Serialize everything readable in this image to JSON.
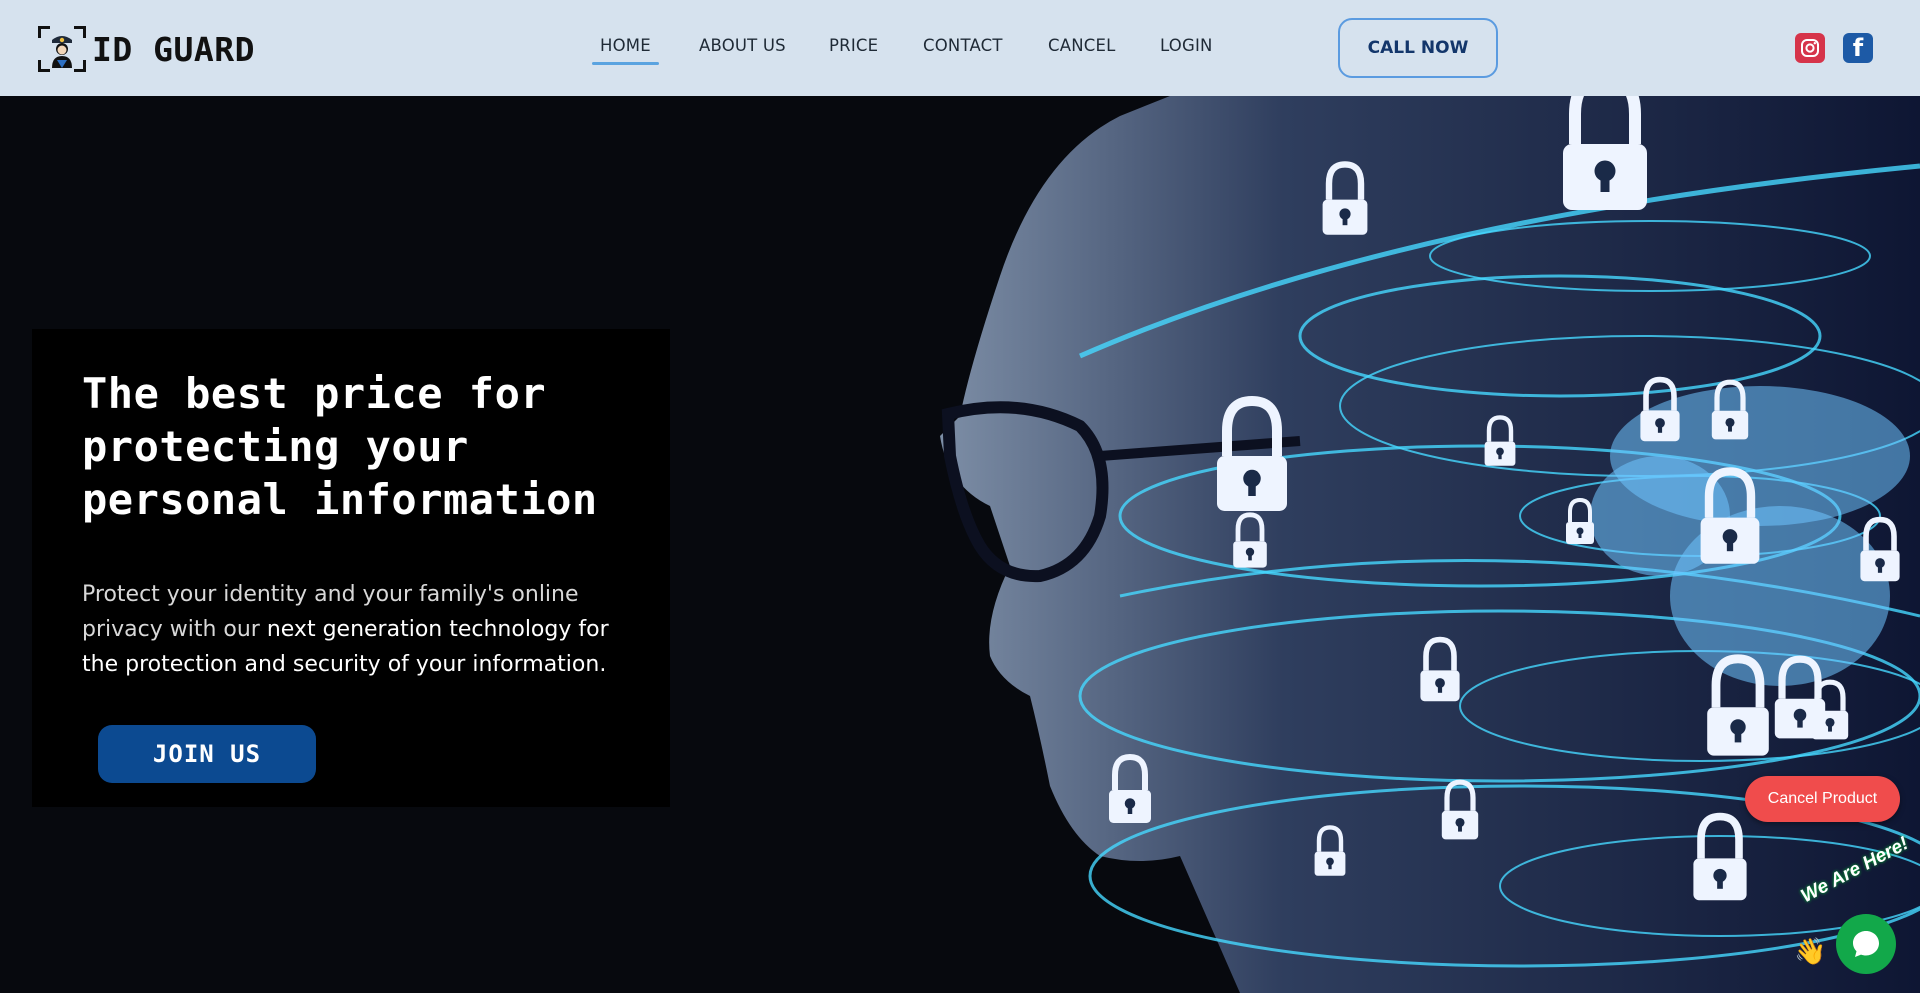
{
  "brand": {
    "name": "ID GUARD",
    "logo_icon": "guard-officer-icon"
  },
  "nav": {
    "items": [
      {
        "label": "HOME",
        "active": true
      },
      {
        "label": "ABOUT US",
        "active": false
      },
      {
        "label": "PRICE",
        "active": false
      },
      {
        "label": "CONTACT",
        "active": false
      },
      {
        "label": "CANCEL",
        "active": false
      },
      {
        "label": "LOGIN",
        "active": false
      }
    ],
    "call_label": "CALL NOW"
  },
  "social": {
    "instagram_icon": "instagram-icon",
    "facebook_icon": "facebook-icon",
    "facebook_glyph": "f"
  },
  "hero": {
    "headline": "The best price for protecting your personal information",
    "lead_light": "Protect your identity and your family's online privacy with our ",
    "lead_strong": "next generation technology for the protection and security of your information.",
    "join_label": "JOIN US"
  },
  "widgets": {
    "cancel_label": "Cancel Product",
    "chat_tagline": "We Are Here!",
    "chat_hand": "👋"
  },
  "colors": {
    "nav_bg": "#d6e2ee",
    "accent_blue": "#0c4a91",
    "call_border": "#5b9be0",
    "cancel_red": "#f04c4c",
    "chat_green": "#12a84a",
    "hero_bg": "#07090e"
  }
}
